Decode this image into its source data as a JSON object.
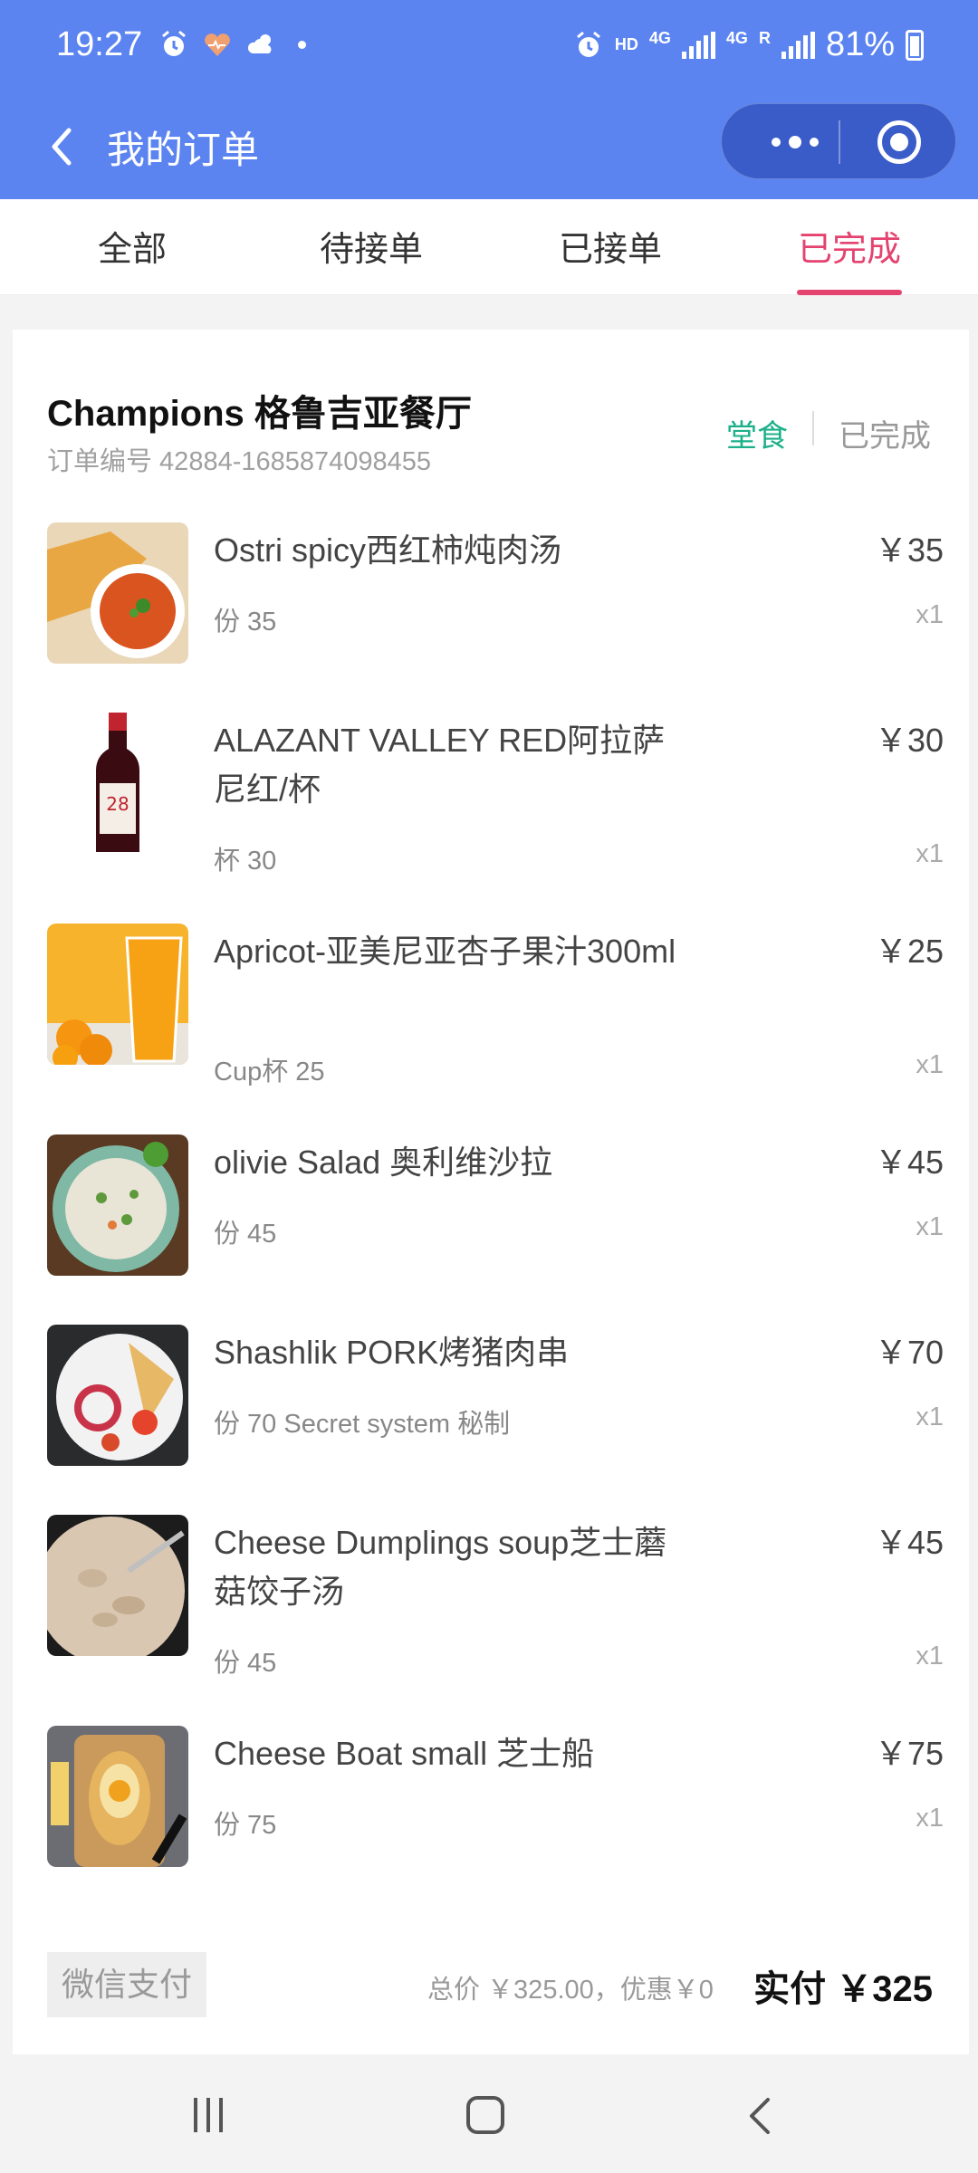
{
  "status_bar": {
    "time": "19:27",
    "network_hd": "HD",
    "network_4g_1": "4G",
    "network_4g_2": "4G",
    "roaming": "R",
    "battery": "81%"
  },
  "header": {
    "title": "我的订单"
  },
  "tabs": [
    {
      "label": "全部"
    },
    {
      "label": "待接单"
    },
    {
      "label": "已接单"
    },
    {
      "label": "已完成"
    }
  ],
  "active_tab": "已完成",
  "colors": {
    "header_bg": "#5b84f0",
    "accent": "#e4436f",
    "dine_in": "#1cb08a"
  },
  "order": {
    "shop_name": "Champions 格鲁吉亚餐厅",
    "order_no": "订单编号 42884-1685874098455",
    "type": "堂食",
    "status": "已完成",
    "items": [
      {
        "name": "Ostri spicy西红柿炖肉汤",
        "spec": "份 35",
        "price": "￥35",
        "qty": "x1"
      },
      {
        "name": "ALAZANT VALLEY RED阿拉萨尼红/杯",
        "spec": "杯 30",
        "price": "￥30",
        "qty": "x1"
      },
      {
        "name": "Apricot-亚美尼亚杏子果汁300ml",
        "spec": "Cup杯 25",
        "price": "￥25",
        "qty": "x1"
      },
      {
        "name": "olivie Salad 奥利维沙拉",
        "spec": "份 45",
        "price": "￥45",
        "qty": "x1"
      },
      {
        "name": "Shashlik PORK烤猪肉串",
        "spec": "份 70 Secret system 秘制",
        "price": "￥70",
        "qty": "x1"
      },
      {
        "name": "Cheese Dumplings soup芝士蘑菇饺子汤",
        "spec": "份 45",
        "price": "￥45",
        "qty": "x1"
      },
      {
        "name": "Cheese Boat small 芝士船",
        "spec": "份 75",
        "price": "￥75",
        "qty": "x1"
      }
    ],
    "pay_method": "微信支付",
    "summary": "总价 ￥325.00，优惠￥0",
    "actual": "实付 ￥325"
  }
}
